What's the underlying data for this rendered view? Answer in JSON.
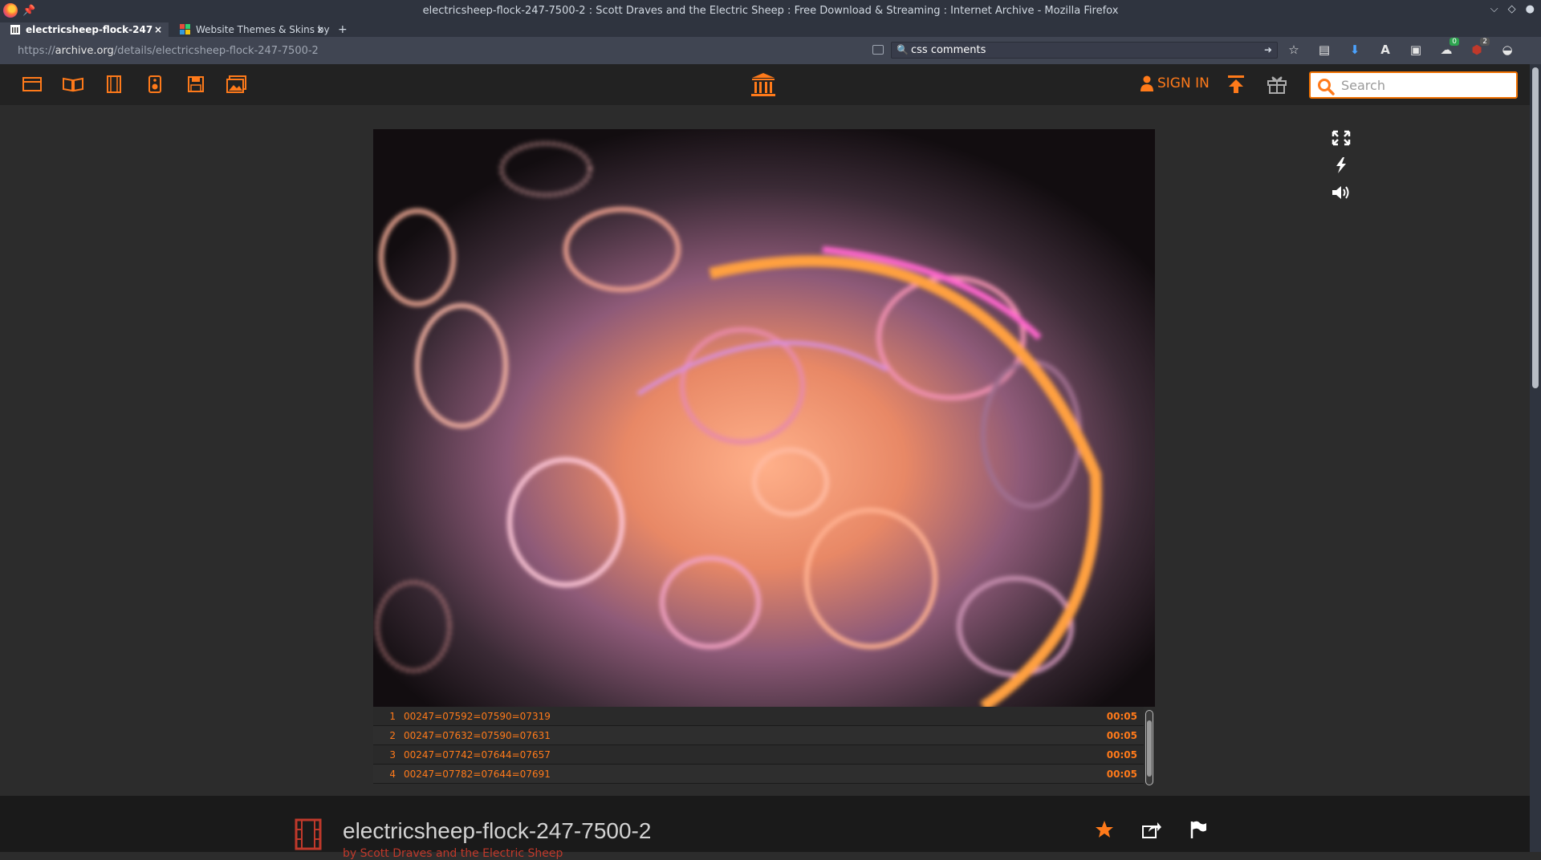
{
  "window": {
    "title": "electricsheep-flock-247-7500-2 : Scott Draves and the Electric Sheep : Free Download & Streaming : Internet Archive - Mozilla Firefox"
  },
  "tabs": [
    {
      "label": "electricsheep-flock-247",
      "close": "×"
    },
    {
      "label": "Website Themes & Skins by",
      "close": "×"
    }
  ],
  "new_tab": "+",
  "url": {
    "scheme": "https://",
    "host": "archive.org",
    "path": "/details/electricsheep-flock-247-7500-2"
  },
  "browser_search": {
    "value": "css comments"
  },
  "toolbar_badges": {
    "green": "0",
    "red": "2"
  },
  "ia_header": {
    "signin_label": "SIGN IN",
    "search_placeholder": "Search",
    "accent": "#ff7a1a"
  },
  "playlist": [
    {
      "num": "1",
      "title": "00247=07592=07590=07319",
      "duration": "00:05"
    },
    {
      "num": "2",
      "title": "00247=07632=07590=07631",
      "duration": "00:05"
    },
    {
      "num": "3",
      "title": "00247=07742=07644=07657",
      "duration": "00:05"
    },
    {
      "num": "4",
      "title": "00247=07782=07644=07691",
      "duration": "00:05"
    }
  ],
  "item": {
    "title": "electricsheep-flock-247-7500-2",
    "byline": "by Scott Draves and the Electric Sheep"
  },
  "icons": {
    "media": [
      "web-icon",
      "texts-icon",
      "video-icon",
      "audio-icon",
      "software-icon",
      "images-icon"
    ],
    "side_controls": [
      "fullscreen-icon",
      "lightning-icon",
      "volume-icon"
    ],
    "actions": [
      "favorite-star-icon",
      "share-icon",
      "flag-icon"
    ]
  }
}
